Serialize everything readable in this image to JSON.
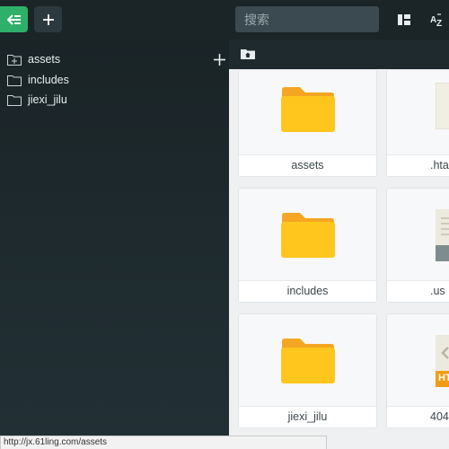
{
  "toolbar": {
    "search_placeholder": "搜索",
    "icons": [
      "back-icon",
      "plus-icon",
      "grid-view-icon",
      "sort-az-icon",
      "more-icon"
    ],
    "accent": "#2eb06a"
  },
  "sidebar": {
    "items": [
      {
        "label": "assets",
        "icon": "folder-plus-icon"
      },
      {
        "label": "includes",
        "icon": "folder-icon"
      },
      {
        "label": "jiexi_jilu",
        "icon": "folder-icon"
      }
    ]
  },
  "files": [
    {
      "name": "assets",
      "type": "folder"
    },
    {
      "name": ".hta",
      "type": "file"
    },
    {
      "name": "includes",
      "type": "folder"
    },
    {
      "name": ".us",
      "type": "file"
    },
    {
      "name": "jiexi_jilu",
      "type": "folder"
    },
    {
      "name": "404",
      "type": "html"
    }
  ],
  "file_badges": {
    "html": "HT"
  },
  "status": {
    "url": "http://jx.61ling.com/assets"
  }
}
